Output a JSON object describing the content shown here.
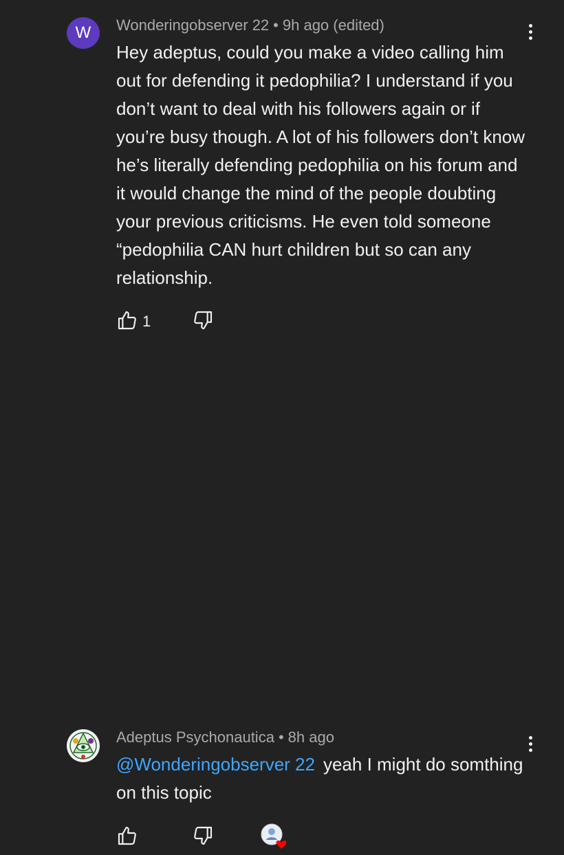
{
  "comments": [
    {
      "avatar_letter": "W",
      "avatar_color": "#5c3bbf",
      "author": "Wonderingobserver 22",
      "separator": "•",
      "time": "9h ago (edited)",
      "text": "Hey adeptus, could you make a video calling him out for defending it pedophilia? I understand if you don’t want to deal with his followers again or if you’re busy though. A lot of his followers don’t know he’s literally defending pedophilia on his forum and it would change the mind of the people doubting your previous criticisms. He even told someone “pedophilia CAN hurt children but so can any relationship.",
      "like_count": "1",
      "icons": [
        "more-vert-icon",
        "thumbs-up-icon",
        "thumbs-down-icon"
      ]
    },
    {
      "author": "Adeptus Psychonautica",
      "separator": "•",
      "time": "8h ago",
      "mention": "@Wonderingobserver 22",
      "text": "yeah I might do somthing on this topic",
      "icons": [
        "more-vert-icon",
        "thumbs-up-icon",
        "thumbs-down-icon",
        "creator-heart-icon"
      ]
    }
  ],
  "colors": {
    "background": "#222222",
    "text": "#f1f1f1",
    "meta": "#aaaaaa",
    "mention": "#3ea6ff",
    "heart": "#ff0000"
  }
}
